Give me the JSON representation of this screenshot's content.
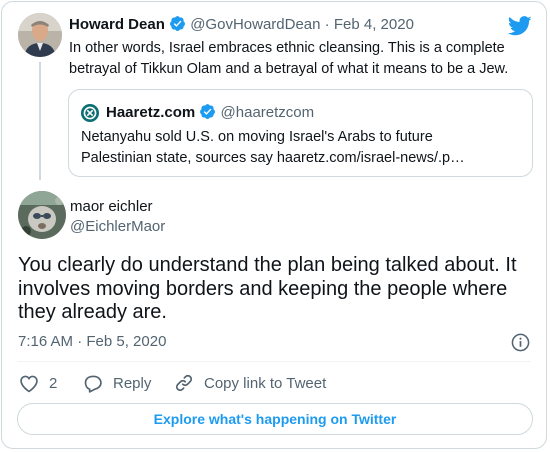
{
  "parent_tweet": {
    "author_name": "Howard Dean",
    "author_handle": "@GovHowardDean",
    "separator": "·",
    "date": "Feb 4, 2020",
    "text_line1": "In other words, Israel embraces ethnic cleansing. This is a complete",
    "text_line2": "betrayal of Tikkun Olam and a betrayal of what it means to be a Jew."
  },
  "quoted_tweet": {
    "author_name": "Haaretz.com",
    "author_handle": "@haaretzcom",
    "text_line1": "Netanyahu sold U.S. on moving Israel's Arabs to future",
    "text_line2": "Palestinian state, sources say haaretz.com/israel-news/.p…"
  },
  "main_tweet": {
    "author_name": "maor eichler",
    "author_handle": "@EichlerMaor",
    "text_line1": "You clearly do understand the plan being talked about. It",
    "text_line2": "involves moving borders and keeping the people where",
    "text_line3": "they already are.",
    "timestamp": "7:16 AM · Feb 5, 2020"
  },
  "actions": {
    "like_count": "2",
    "reply_label": "Reply",
    "copy_link_label": "Copy link to Tweet"
  },
  "explore_label": "Explore what's happening on Twitter",
  "colors": {
    "twitter_blue": "#1d9bf0",
    "text_primary": "#0f1419",
    "text_secondary": "#536471",
    "border": "#cfd9de"
  }
}
